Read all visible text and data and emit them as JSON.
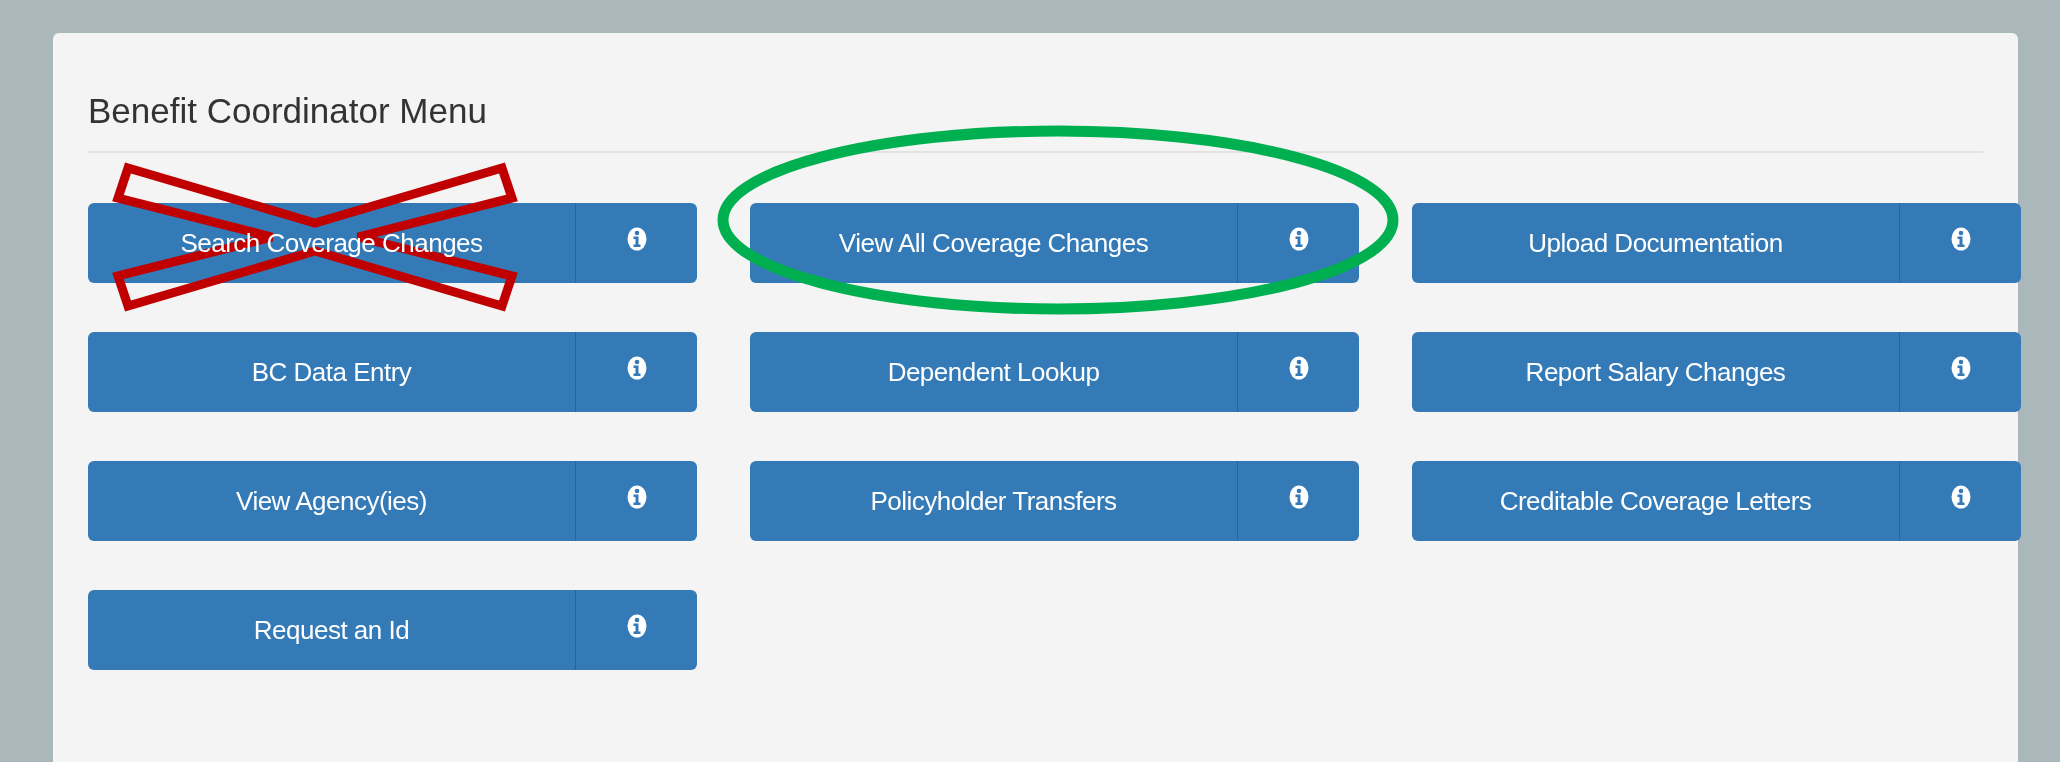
{
  "title": "Benefit Coordinator Menu",
  "buttons": [
    {
      "label": "Search Coverage Changes",
      "crossed_out": true,
      "circled": false
    },
    {
      "label": "View All Coverage Changes",
      "crossed_out": false,
      "circled": true
    },
    {
      "label": "Upload Documentation",
      "crossed_out": false,
      "circled": false
    },
    {
      "label": "BC Data Entry",
      "crossed_out": false,
      "circled": false
    },
    {
      "label": "Dependent Lookup",
      "crossed_out": false,
      "circled": false
    },
    {
      "label": "Report Salary Changes",
      "crossed_out": false,
      "circled": false
    },
    {
      "label": "View Agency(ies)",
      "crossed_out": false,
      "circled": false
    },
    {
      "label": "Policyholder Transfers",
      "crossed_out": false,
      "circled": false
    },
    {
      "label": "Creditable Coverage Letters",
      "crossed_out": false,
      "circled": false
    },
    {
      "label": "Request an Id",
      "crossed_out": false,
      "circled": false
    }
  ]
}
